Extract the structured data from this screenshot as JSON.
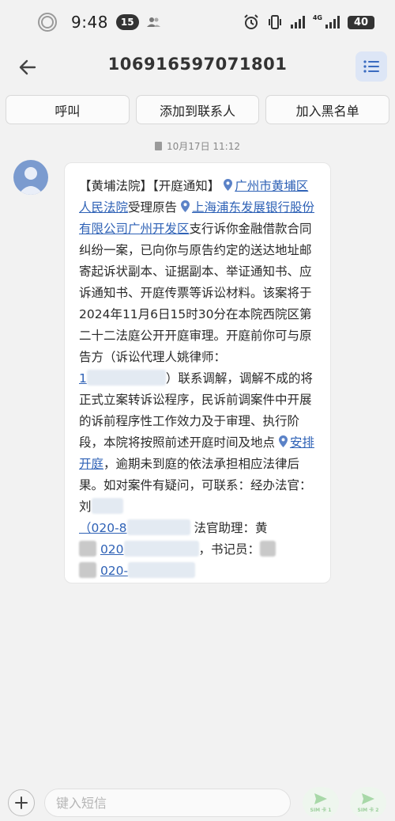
{
  "status_bar": {
    "time": "9:48",
    "notification_count": "15",
    "network": "4G",
    "battery": "40"
  },
  "header": {
    "title": "106916597071801"
  },
  "actions": {
    "call": "呼叫",
    "add_contact": "添加到联系人",
    "block": "加入黑名单"
  },
  "message": {
    "date": "10月17日 11:12",
    "seg1": "【黄埔法院】【开庭通知】",
    "link1": "广州市黄埔区人民法院",
    "seg2": "受理原告",
    "link2": "上海浦东发展银行股份有限公司广州开发区",
    "seg3": "支行诉你金融借款合同纠纷一案，已向你与原告约定的送达地址邮寄起诉状副本、证据副本、举证通知书、应诉通知书、开庭传票等诉讼材料。该案将于2024年11月6日15时30分在本院西院区第二十二法庭公开开庭审理。开庭前你可与原告方（诉讼代理人姚律师：",
    "phone1_visible": "1",
    "seg4": "）联系调解，调解不成的将正式立案转诉讼程序，民诉前调案件中开展的诉前程序性工作效力及于审理、执行阶段，本院将按照前述开庭时间及地点",
    "link3": "安排开庭",
    "seg5": "，逾期未到庭的依法承担相应法律后果。如对案件有疑问，可联系：经办法官：",
    "seg5b": "刘",
    "phone2_visible": "（020-8",
    "seg6": "法官助理：黄",
    "phone3_visible": "020",
    "seg7": "，书记员：",
    "phone4_visible": "020-"
  },
  "composer": {
    "placeholder": "键入短信",
    "send_sim1": "SIM 卡 1",
    "send_sim2": "SIM 卡 2"
  },
  "colors": {
    "accent": "#2f62b6",
    "menu_bg": "#dde6f6",
    "send_tint": "#9ccf9c"
  }
}
